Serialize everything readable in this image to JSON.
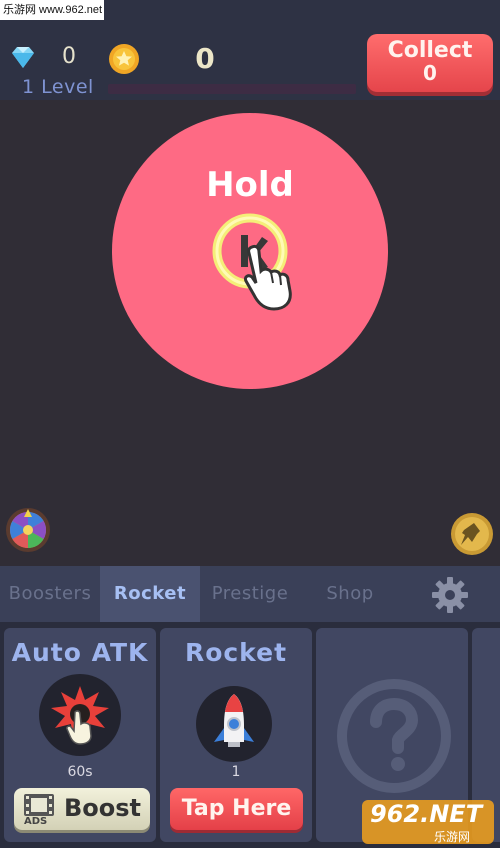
{
  "watermark": "乐游网 www.962.net",
  "header": {
    "diamond_icon": "diamond-icon",
    "diamond_count": "0",
    "coin_icon": "coin-icon",
    "coin_count": "0",
    "level_label": "1 Level",
    "level_progress": 0,
    "collect_label": "Collect",
    "collect_value": "0"
  },
  "main": {
    "hold_label": "Hold",
    "left_icon": "fortune-wheel-icon",
    "right_icon": "pin-icon"
  },
  "tabs": [
    {
      "label": "Boosters",
      "active": false
    },
    {
      "label": "Rocket",
      "active": true
    },
    {
      "label": "Prestige",
      "active": false
    },
    {
      "label": "Shop",
      "active": false
    }
  ],
  "settings_icon": "gear-icon",
  "cards": {
    "auto_atk": {
      "title": "Auto ATK",
      "sub": "60s",
      "button_label": "Boost",
      "ads_label": "ADS"
    },
    "rocket": {
      "title": "Rocket",
      "sub": "1",
      "button_label": "Tap Here"
    },
    "locked": {
      "icon": "question-icon"
    }
  },
  "overlay_logo": {
    "text": "962.NET",
    "sub": "乐游网"
  },
  "colors": {
    "background": "#302d36",
    "hold_circle": "#fe6a84",
    "collect_button": "#e5454b",
    "tab_active_text": "#a7c0f4",
    "card_title": "#9db4ee"
  }
}
